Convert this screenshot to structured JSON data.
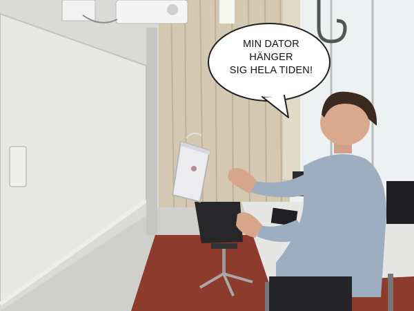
{
  "speech_bubble": {
    "lines": [
      "MIN DATOR",
      "HÄNGER",
      "SIG HELA TIDEN!"
    ]
  },
  "colors": {
    "wall": "#d8d8d6",
    "curtain": "#d2c6b2",
    "floor": "#8f3a2a",
    "shirt": "#9fb0c2",
    "laptop": "#e9e9ec"
  }
}
